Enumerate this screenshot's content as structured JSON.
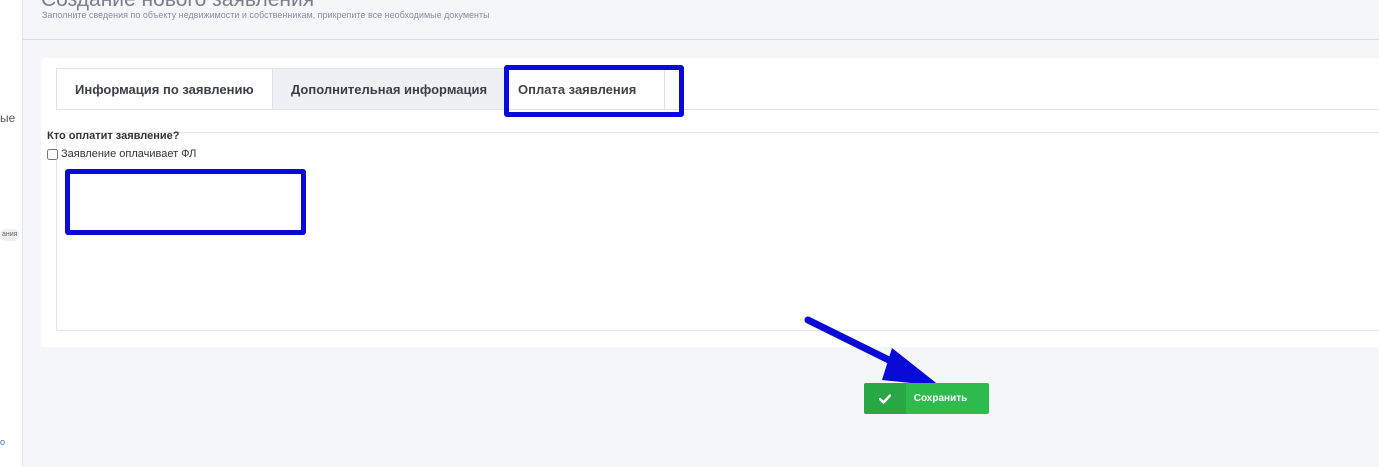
{
  "sidebar": {
    "fragment_1": "ые",
    "fragment_2": "ания",
    "fragment_3": "о"
  },
  "header": {
    "title": "Создание нового заявления",
    "subtitle": "Заполните сведения по объекту недвижимости и собственникам, прикрепите все необходимые документы"
  },
  "tabs": [
    {
      "label": "Информация по заявлению"
    },
    {
      "label": "Дополнительная информация"
    },
    {
      "label": "Оплата заявления"
    }
  ],
  "payment": {
    "question": "Кто оплатит заявление?",
    "checkbox_label": "Заявление оплачивает ФЛ",
    "checkbox_checked": false
  },
  "actions": {
    "save_label": "Сохранить"
  },
  "colors": {
    "highlight": "#0a0ad8",
    "save_button": "#2dbb4e"
  }
}
